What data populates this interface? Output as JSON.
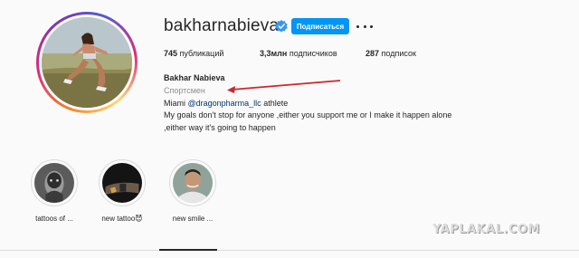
{
  "profile": {
    "username": "bakharnabieva",
    "follow_label": "Подписаться",
    "full_name": "Bakhar Nabieva",
    "category": "Спортсмен",
    "bio": {
      "line1_prefix": "Miami ",
      "mention": "@dragonpharma_llc",
      "line1_suffix": " athlete",
      "line2": "My goals don't stop for anyone ,either you support me or I make it happen alone",
      "line3": ",either way it's going to happen"
    }
  },
  "stats": {
    "posts_value": "745",
    "posts_label": " публикаций",
    "followers_value": "3,3млн",
    "followers_label": " подписчиков",
    "following_value": "287",
    "following_label": " подписок"
  },
  "highlights": [
    {
      "label": "tattoos of ..."
    },
    {
      "label": "new tattoo😈"
    },
    {
      "label": "new smile ..."
    }
  ],
  "watermark": "YAPLAKAL.COM",
  "colors": {
    "follow_button": "#0095f6",
    "verified_badge": "#3897f0",
    "annotation_arrow": "#d0262b",
    "mention": "#00376b"
  },
  "icons": [
    "verified-badge-icon",
    "more-options-icon"
  ]
}
